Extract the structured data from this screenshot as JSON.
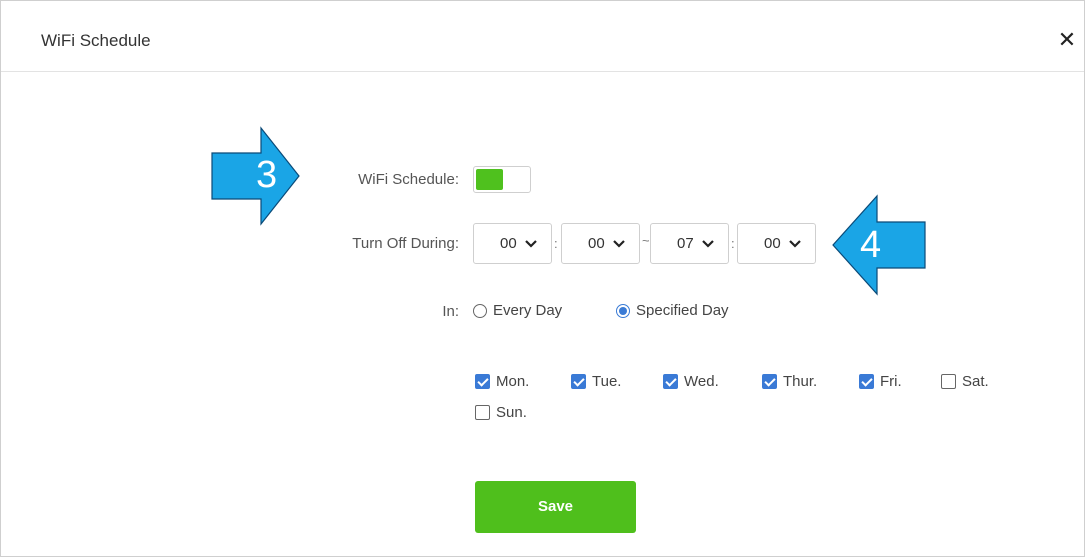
{
  "dialog": {
    "title": "WiFi Schedule",
    "close_glyph": "✕"
  },
  "form": {
    "schedule_label": "WiFi Schedule:",
    "schedule_enabled": true,
    "turn_off_label": "Turn Off During:",
    "start_hour": "00",
    "start_minute": "00",
    "range_separator": "~",
    "time_separator": ":",
    "end_hour": "07",
    "end_minute": "00",
    "in_label": "In:",
    "radio_every_day": "Every Day",
    "radio_specified_day": "Specified Day",
    "selected_mode": "Specified Day",
    "days": [
      {
        "label": "Mon.",
        "checked": true
      },
      {
        "label": "Tue.",
        "checked": true
      },
      {
        "label": "Wed.",
        "checked": true
      },
      {
        "label": "Thur.",
        "checked": true
      },
      {
        "label": "Fri.",
        "checked": true
      },
      {
        "label": "Sat.",
        "checked": false
      },
      {
        "label": "Sun.",
        "checked": false
      }
    ],
    "save_label": "Save"
  },
  "annotations": {
    "callout_3": "3",
    "callout_4": "4",
    "arrow_color": "#1aa5e6"
  },
  "colors": {
    "accent_green": "#4fbf1c",
    "checkbox_blue": "#3a7ad6"
  }
}
